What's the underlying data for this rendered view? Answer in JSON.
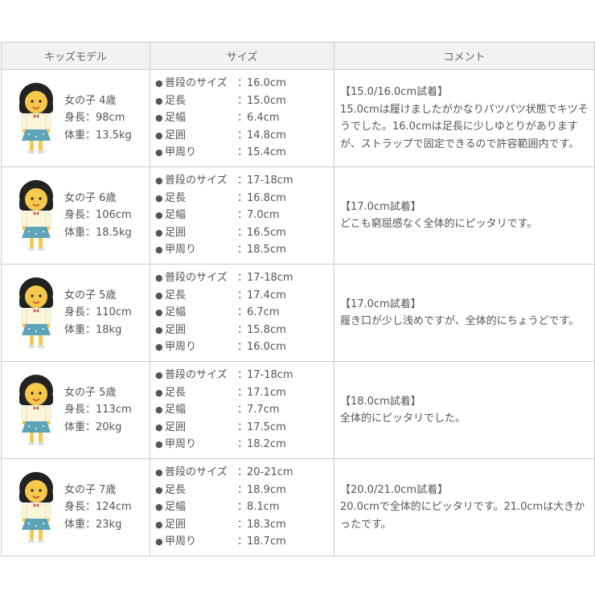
{
  "table": {
    "headers": [
      "キッズモデル",
      "サイズ",
      "コメント"
    ],
    "rows": [
      {
        "model": {
          "gender_age": "女の子 4歳",
          "height": "身長：98cm",
          "weight": "体重：13.5kg"
        },
        "sizes": [
          {
            "label": "普段のサイズ",
            "value": "16.0cm"
          },
          {
            "label": "足長",
            "value": "15.0cm"
          },
          {
            "label": "足幅",
            "value": "6.4cm"
          },
          {
            "label": "足囲",
            "value": "14.8cm"
          },
          {
            "label": "甲周り",
            "value": "15.4cm"
          }
        ],
        "comment": {
          "title": "【15.0/16.0cm試着】",
          "body": "15.0cmは履けましたがかなりパツパツ状態でキツそうでした。16.0cmは足長に少しゆとりがありますが、ストラップで固定できるので許容範囲内です。"
        }
      },
      {
        "model": {
          "gender_age": "女の子 6歳",
          "height": "身長：106cm",
          "weight": "体重：18.5kg"
        },
        "sizes": [
          {
            "label": "普段のサイズ",
            "value": "17-18cm"
          },
          {
            "label": "足長",
            "value": "16.8cm"
          },
          {
            "label": "足幅",
            "value": "7.0cm"
          },
          {
            "label": "足囲",
            "value": "16.5cm"
          },
          {
            "label": "甲周り",
            "value": "18.5cm"
          }
        ],
        "comment": {
          "title": "【17.0cm試着】",
          "body": "どこも窮屈感なく全体的にピッタリです。"
        }
      },
      {
        "model": {
          "gender_age": "女の子 5歳",
          "height": "身長：110cm",
          "weight": "体重：18kg"
        },
        "sizes": [
          {
            "label": "普段のサイズ",
            "value": "17-18cm"
          },
          {
            "label": "足長",
            "value": "17.4cm"
          },
          {
            "label": "足幅",
            "value": "6.7cm"
          },
          {
            "label": "足囲",
            "value": "15.8cm"
          },
          {
            "label": "甲周り",
            "value": "16.0cm"
          }
        ],
        "comment": {
          "title": "【17.0cm試着】",
          "body": "履き口が少し浅めですが、全体的にちょうどです。"
        }
      },
      {
        "model": {
          "gender_age": "女の子 5歳",
          "height": "身長：113cm",
          "weight": "体重：20kg"
        },
        "sizes": [
          {
            "label": "普段のサイズ",
            "value": "17-18cm"
          },
          {
            "label": "足長",
            "value": "17.1cm"
          },
          {
            "label": "足幅",
            "value": "7.7cm"
          },
          {
            "label": "足囲",
            "value": "17.5cm"
          },
          {
            "label": "甲周り",
            "value": "18.2cm"
          }
        ],
        "comment": {
          "title": "【18.0cm試着】",
          "body": "全体的にピッタリでした。"
        }
      },
      {
        "model": {
          "gender_age": "女の子 7歳",
          "height": "身長：124cm",
          "weight": "体重：23kg"
        },
        "sizes": [
          {
            "label": "普段のサイズ",
            "value": "20-21cm"
          },
          {
            "label": "足長",
            "value": "18.9cm"
          },
          {
            "label": "足幅",
            "value": "8.1cm"
          },
          {
            "label": "足囲",
            "value": "18.3cm"
          },
          {
            "label": "甲周り",
            "value": "18.7cm"
          }
        ],
        "comment": {
          "title": "【20.0/21.0cm試着】",
          "body": "20.0cmで全体的にピッタリです。21.0cmは大きかったです。"
        }
      }
    ]
  },
  "colors": {
    "border": "#cccccc",
    "header_bg": "#f2f2f2",
    "text": "#555555",
    "skin": "#f6c94c",
    "shirt": "#faf6dc",
    "skirt": "#5ea4b8",
    "bow": "#d23c2c",
    "hair": "#222222"
  },
  "icons": {
    "avatar": "girl-avatar-icon",
    "bullet": "bullet-icon"
  }
}
